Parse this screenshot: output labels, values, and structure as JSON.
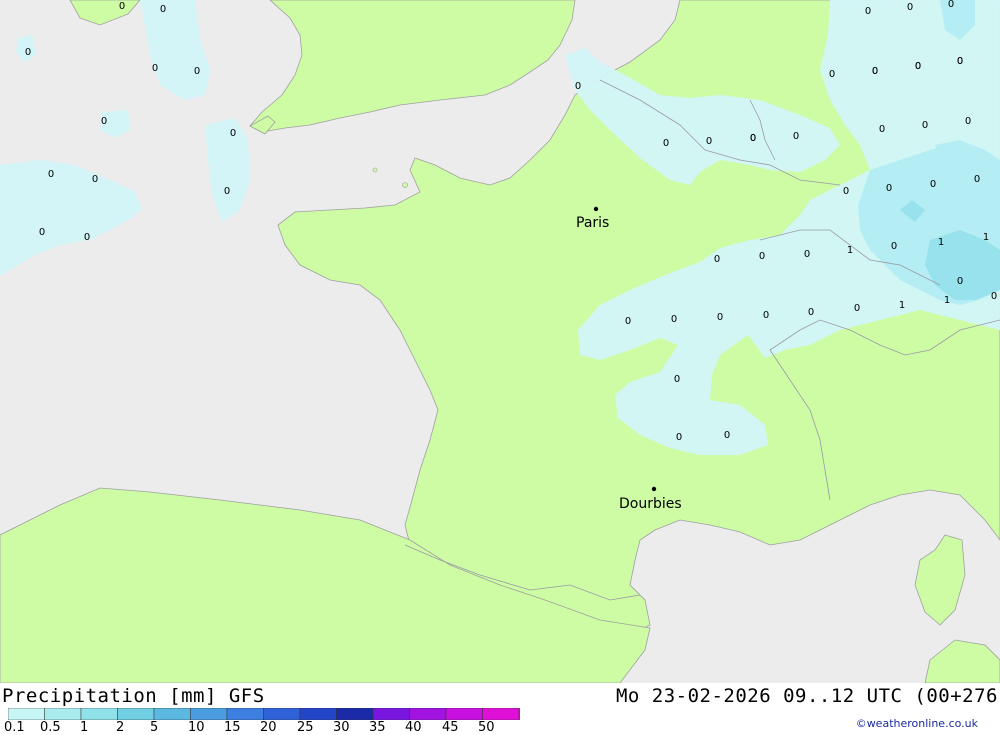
{
  "map": {
    "cities": [
      {
        "name": "Paris"
      },
      {
        "name": "Dourbies"
      }
    ],
    "precip_values": [
      "0",
      "0",
      "0",
      "0",
      "0",
      "0",
      "0",
      "0",
      "0",
      "0",
      "0",
      "0",
      "0",
      "0",
      "0",
      "0",
      "0",
      "0",
      "0",
      "0",
      "0",
      "0",
      "0",
      "0",
      "0",
      "0",
      "0",
      "0",
      "0",
      "0",
      "0",
      "0",
      "0",
      "0",
      "0",
      "0",
      "0",
      "0",
      "0",
      "0",
      "1",
      "1",
      "1",
      "1",
      "1",
      "0",
      "0",
      "0",
      "0",
      "0",
      "0",
      "0",
      "0",
      "0",
      "0"
    ]
  },
  "footer": {
    "title": "Precipitation [mm] GFS",
    "valid_time": "Mo 23-02-2026 09..12 UTC (00+276",
    "credit": "©weatheronline.co.uk",
    "legend": {
      "labels": [
        "0.1",
        "0.5",
        "1",
        "2",
        "5",
        "10",
        "15",
        "20",
        "25",
        "30",
        "35",
        "40",
        "45",
        "50"
      ],
      "colors": [
        "#c8f5f5",
        "#a8ecf0",
        "#8fe1ea",
        "#70cfe2",
        "#5bb8e0",
        "#4a9de0",
        "#3c7fe0",
        "#2f62d8",
        "#2346c8",
        "#1a2aa8",
        "#7a16e0",
        "#a212e0",
        "#c810e0",
        "#e010d8",
        "#b010b0"
      ]
    }
  },
  "colors": {
    "sea": "#ececec",
    "land": "#cdfca4",
    "precip_light": "#d2f6f8",
    "precip_medium": "#aeeef2",
    "precip_heavy": "#8fe1ea",
    "coast": "#a0a0a0"
  }
}
